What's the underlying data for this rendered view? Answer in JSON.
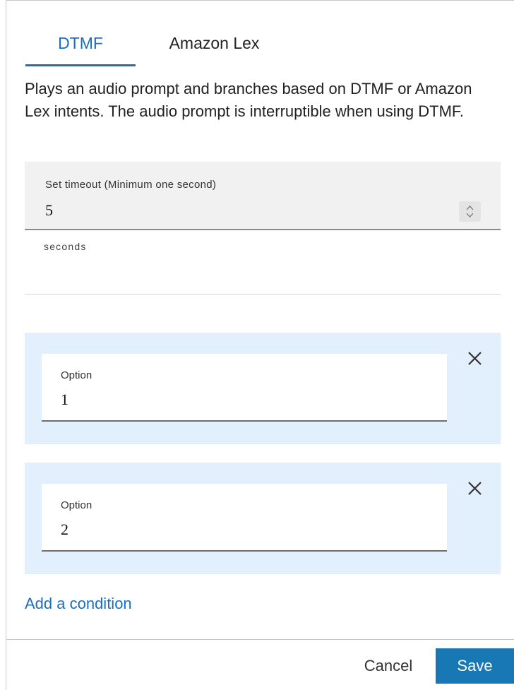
{
  "tabs": [
    {
      "label": "DTMF",
      "active": true
    },
    {
      "label": "Amazon Lex",
      "active": false
    }
  ],
  "description": "Plays an audio prompt and branches based on DTMF or Amazon Lex intents. The audio prompt is interruptible when using DTMF.",
  "timeout": {
    "label": "Set timeout (Minimum one second)",
    "value": "5",
    "unit": "seconds"
  },
  "conditions": [
    {
      "label": "Option",
      "value": "1"
    },
    {
      "label": "Option",
      "value": "2"
    }
  ],
  "add_condition": "Add a condition",
  "footer": {
    "cancel": "Cancel",
    "save": "Save"
  },
  "colors": {
    "accent": "#1a6fc2",
    "save_button": "#1778b4",
    "condition_bg": "#e2effc",
    "field_bg": "#f1f1f1"
  },
  "icons": {
    "spinner": "stepper-arrows-icon",
    "remove": "close-icon"
  }
}
